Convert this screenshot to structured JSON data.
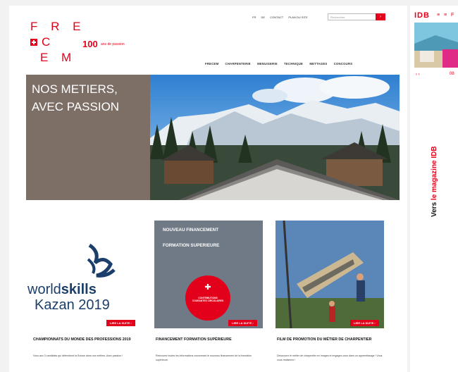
{
  "brand": {
    "logo_line1": "F R E",
    "logo_line2": "C",
    "logo_line3": "E M",
    "centenary": "100",
    "centenary_sub": "ans de passion"
  },
  "toplinks": [
    "FR",
    "DE",
    "CONTACT",
    "PLAN DU SITE"
  ],
  "search": {
    "placeholder": "Rechercher",
    "button": "›"
  },
  "nav": [
    "FRECEM",
    "CHARPENTERIE",
    "MENUISERIE",
    "TECHNIQUE",
    "METTAGES",
    "CONCOURS"
  ],
  "hero": {
    "line1": "NOS METIERS,",
    "line2": "AVEC PASSION"
  },
  "cards": [
    {
      "logo_world": "world",
      "logo_skills": "skills",
      "logo_city": "Kazan 2019",
      "badge": "LIRE LA SUITE ›",
      "title": "CHAMPIONNATS DU MONDE DES PROFESSIONS 2019",
      "desc": "Vous aux 3 candidats qui défendront la Suisse dans nos métiers. Avec passion !"
    },
    {
      "overlay1": "NOUVEAU FINANCEMENT",
      "overlay2": "FORMATION SUPERIEURE",
      "circle_text": "CONTRIBUTIONS COURANTES CIRCULAIRES",
      "badge": "LIRE LA SUITE ›",
      "title": "FINANCEMENT FORMATION SUPÉRIEURE",
      "desc": "Retrouvez toutes les informations concernant le nouveau financement de la formation supérieure."
    },
    {
      "badge": "LIRE LA SUITE ›",
      "title": "FILM DE PROMOTION DU MÉTIER DE CHARPENTIER",
      "desc": "Découvrez le métier de charpentier en images et engagez-vous dans un apprentissage ! Vous vous réaliserez !"
    }
  ],
  "side": {
    "logo": "IDB",
    "flags": "≡ ≡ F",
    "vertical_prefix": "Vers",
    "vertical_red": "le magazine IDB",
    "nav_prev": "‹ ›",
    "page_num": "08"
  },
  "colors": {
    "brand_red": "#e2001a",
    "hero_brown": "#7d6e66",
    "card_gray": "#6f7a86"
  }
}
